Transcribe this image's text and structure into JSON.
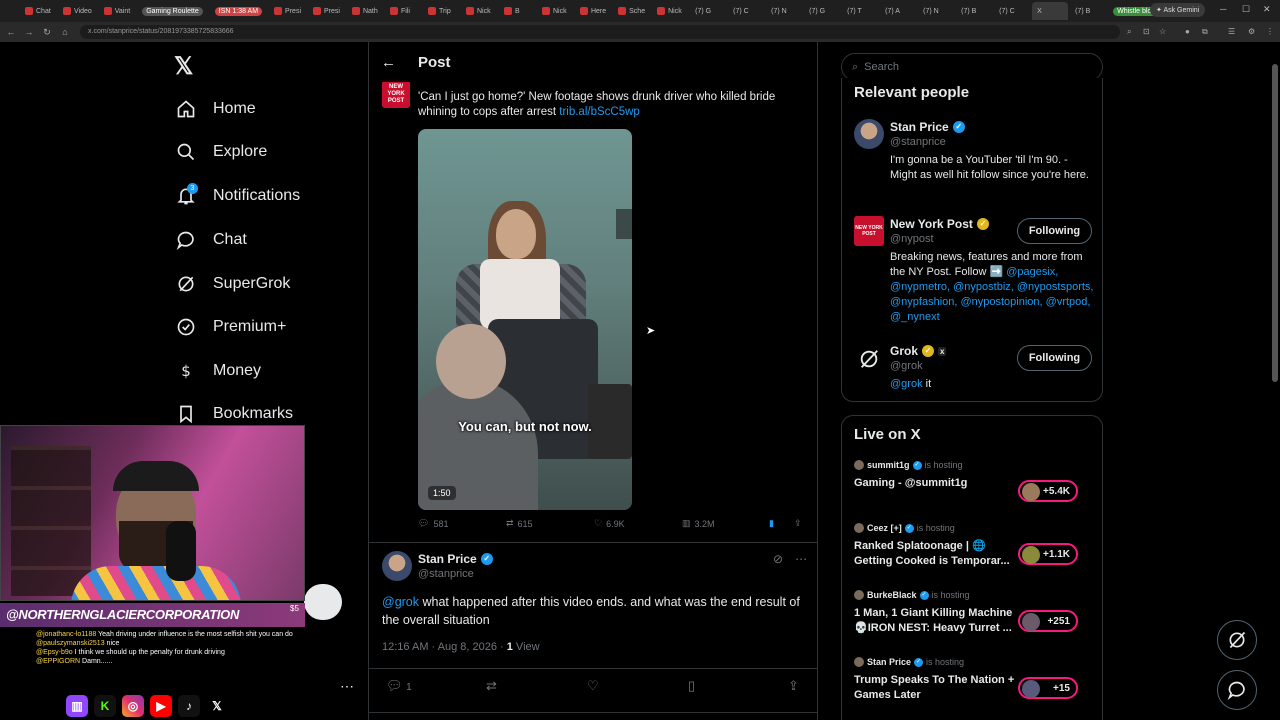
{
  "browser": {
    "tabs": [
      "Chat",
      "Video",
      "Vaint",
      "Gaming Roulette",
      "ISN 1:38 AM",
      "Presi",
      "Presi",
      "Nath",
      "Fili",
      "Trip",
      "Nick",
      "B",
      "Nick",
      "Here",
      "Sche",
      "Nick",
      "(7) G",
      "(7) C",
      "(7) N",
      "(7) G",
      "(7) T",
      "(7) A",
      "(7) N",
      "(7) B",
      "(7) C",
      "X",
      "(7) B",
      "Whistle blow Call"
    ],
    "ask_gemini": "Ask Gemini",
    "url": "x.com/stanprice/status/2081973385725833666"
  },
  "nav": {
    "items": [
      {
        "label": "Home",
        "icon": "home-icon"
      },
      {
        "label": "Explore",
        "icon": "search-icon"
      },
      {
        "label": "Notifications",
        "icon": "bell-icon"
      },
      {
        "label": "Chat",
        "icon": "chat-icon"
      },
      {
        "label": "SuperGrok",
        "icon": "grok-icon"
      },
      {
        "label": "Premium+",
        "icon": "verified-icon"
      },
      {
        "label": "Money",
        "icon": "money-icon"
      },
      {
        "label": "Bookmarks",
        "icon": "bookmark-icon"
      }
    ],
    "notif_count": "3",
    "more_icon": "⋯"
  },
  "post": {
    "header_title": "Post",
    "quoted": {
      "avatar_text": "NEW YORK POST",
      "text": "'Can I just go home?' New footage shows drunk driver who killed bride whining to cops after arrest ",
      "link": "trib.al/bScC5wp",
      "video_caption": "You can, but not now.",
      "video_duration": "1:50"
    },
    "stats": {
      "replies": "581",
      "reposts": "615",
      "likes": "6.9K",
      "views": "3.2M"
    },
    "reply": {
      "name": "Stan Price",
      "handle": "@stanprice",
      "mention": "@grok",
      "text": " what happened after this video ends. and what was the end result of the overall situation",
      "time": "12:16 AM · Aug 8, 2026 · ",
      "views_count": "1",
      "views_label": " View",
      "reply_count": "1"
    }
  },
  "right": {
    "search_placeholder": "Search",
    "relevant_title": "Relevant people",
    "people": [
      {
        "name": "Stan Price",
        "handle": "@stanprice",
        "bio": "I'm gonna be a YouTuber 'til I'm 90. - Might as well hit follow since you're here."
      },
      {
        "name": "New York Post",
        "handle": "@nypost",
        "bio_pre": "Breaking news, features and more from the NY Post. Follow ➡️ ",
        "bio_links": "@pagesix, @nypmetro, @nypostbiz, @nypostsports, @nypfashion, @nypostopinion, @vrtpod, @_nynext",
        "button": "Following"
      },
      {
        "name": "Grok",
        "handle": "@grok",
        "bio_link": "@grok",
        "bio_post": " it",
        "button": "Following"
      }
    ],
    "live_title": "Live on X",
    "live": [
      {
        "host": "summit1g",
        "status": "is hosting",
        "title": "Gaming - @summit1g",
        "count": "+5.4K"
      },
      {
        "host": "Ceez [+]",
        "status": "is hosting",
        "title": "Ranked Splatoonage | 🌐 Getting Cooked is Temporar...",
        "count": "+1.1K"
      },
      {
        "host": "BurkeBlack",
        "status": "is hosting",
        "title": "1 Man, 1 Giant Killing Machine 💀IRON NEST: Heavy Turret ...",
        "count": "+251"
      },
      {
        "host": "Stan Price",
        "status": "is hosting",
        "title": "Trump Speaks To The Nation + Games Later",
        "count": "+15"
      }
    ]
  },
  "overlay": {
    "channel": "@NORTHERNGLACIERCORPORATION",
    "donation": "$5",
    "chat": [
      {
        "user": "@jonathanc-lo1188",
        "msg": "Yeah driving under influence is the most selfish shit you can do"
      },
      {
        "user": "@paulszymanski2513",
        "msg": "nice"
      },
      {
        "user": "@Epsy-b9o",
        "msg": "I think we should up the penalty for drunk driving"
      },
      {
        "user": "@EPPIGORN",
        "msg": "Damn......"
      }
    ]
  }
}
